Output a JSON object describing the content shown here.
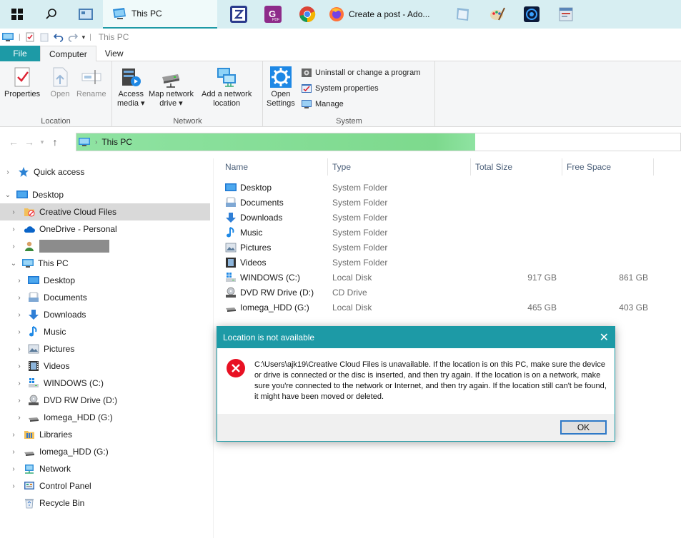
{
  "taskbar": {
    "active_window_label": "This PC",
    "firefox_label": "Create a post - Ado..."
  },
  "qat": {
    "title": "This PC"
  },
  "tabs": {
    "file": "File",
    "computer": "Computer",
    "view": "View"
  },
  "ribbon": {
    "location": {
      "label": "Location",
      "properties": "Properties",
      "open": "Open",
      "rename": "Rename"
    },
    "network": {
      "label": "Network",
      "access_media_1": "Access",
      "access_media_2": "media ▾",
      "map_drive_1": "Map network",
      "map_drive_2": "drive ▾",
      "add_location_1": "Add a network",
      "add_location_2": "location"
    },
    "system": {
      "label": "System",
      "open_settings_1": "Open",
      "open_settings_2": "Settings",
      "uninstall": "Uninstall or change a program",
      "system_properties": "System properties",
      "manage": "Manage"
    }
  },
  "address": {
    "crumb": "This PC",
    "progress": 0.66
  },
  "nav": {
    "quick_access": "Quick access",
    "desktop": "Desktop",
    "creative_cloud": "Creative Cloud Files",
    "onedrive": "OneDrive - Personal",
    "this_pc": "This PC",
    "pc_desktop": "Desktop",
    "pc_documents": "Documents",
    "pc_downloads": "Downloads",
    "pc_music": "Music",
    "pc_pictures": "Pictures",
    "pc_videos": "Videos",
    "pc_windows": "WINDOWS (C:)",
    "pc_dvd": "DVD RW Drive (D:)",
    "pc_iomega": "Iomega_HDD (G:)",
    "libraries": "Libraries",
    "iomega": "Iomega_HDD (G:)",
    "network": "Network",
    "control_panel": "Control Panel",
    "recycle_bin": "Recycle Bin"
  },
  "columns": {
    "name": "Name",
    "type": "Type",
    "total": "Total Size",
    "free": "Free Space"
  },
  "files": [
    {
      "name": "Desktop",
      "type": "System Folder",
      "total": "",
      "free": ""
    },
    {
      "name": "Documents",
      "type": "System Folder",
      "total": "",
      "free": ""
    },
    {
      "name": "Downloads",
      "type": "System Folder",
      "total": "",
      "free": ""
    },
    {
      "name": "Music",
      "type": "System Folder",
      "total": "",
      "free": ""
    },
    {
      "name": "Pictures",
      "type": "System Folder",
      "total": "",
      "free": ""
    },
    {
      "name": "Videos",
      "type": "System Folder",
      "total": "",
      "free": ""
    },
    {
      "name": "WINDOWS (C:)",
      "type": "Local Disk",
      "total": "917 GB",
      "free": "861 GB"
    },
    {
      "name": "DVD RW Drive (D:)",
      "type": "CD Drive",
      "total": "",
      "free": ""
    },
    {
      "name": "Iomega_HDD (G:)",
      "type": "Local Disk",
      "total": "465 GB",
      "free": "403 GB"
    }
  ],
  "dialog": {
    "title": "Location is not available",
    "message": "C:\\Users\\ajk19\\Creative Cloud Files is unavailable. If the location is on this PC, make sure the device or drive is connected or the disc is inserted, and then try again. If the location is on a network, make sure you're connected to the network or Internet, and then try again. If the location still can't be found, it might have been moved or deleted.",
    "ok": "OK"
  },
  "colors": {
    "accent": "#1d9aa6",
    "taskbar": "#d7eef2",
    "progress": "#7dd98d",
    "error": "#e81123"
  }
}
